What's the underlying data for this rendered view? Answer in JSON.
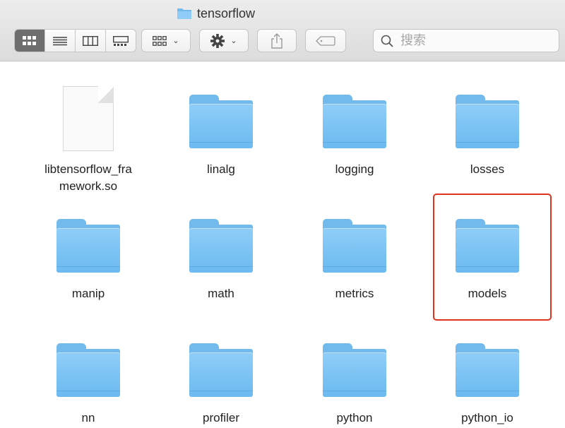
{
  "window": {
    "title": "tensorflow",
    "title_icon": "folder-icon"
  },
  "toolbar": {
    "view_modes": [
      {
        "name": "icon-view",
        "icon": "grid-icon",
        "active": true
      },
      {
        "name": "list-view",
        "icon": "list-icon",
        "active": false
      },
      {
        "name": "column-view",
        "icon": "columns-icon",
        "active": false
      },
      {
        "name": "gallery-view",
        "icon": "gallery-icon",
        "active": false
      }
    ],
    "group_icon": "group-by-icon",
    "action_icon": "gear-icon",
    "share_icon": "share-icon",
    "tag_icon": "tag-icon",
    "dropdown_arrow": "⌄",
    "search": {
      "placeholder": "搜索",
      "value": ""
    }
  },
  "items": [
    {
      "name": "libtensorflow_framework.so",
      "label_line1": "libtensorflow_fra",
      "label_line2": "mework.so",
      "type": "document"
    },
    {
      "name": "linalg",
      "label": "linalg",
      "type": "folder"
    },
    {
      "name": "logging",
      "label": "logging",
      "type": "folder"
    },
    {
      "name": "losses",
      "label": "losses",
      "type": "folder"
    },
    {
      "name": "manip",
      "label": "manip",
      "type": "folder"
    },
    {
      "name": "math",
      "label": "math",
      "type": "folder"
    },
    {
      "name": "metrics",
      "label": "metrics",
      "type": "folder"
    },
    {
      "name": "models",
      "label": "models",
      "type": "folder",
      "highlighted": true
    },
    {
      "name": "nn",
      "label": "nn",
      "type": "folder"
    },
    {
      "name": "profiler",
      "label": "profiler",
      "type": "folder"
    },
    {
      "name": "python",
      "label": "python",
      "type": "folder"
    },
    {
      "name": "python_io",
      "label": "python_io",
      "type": "folder"
    }
  ],
  "colors": {
    "folder_blue": "#72b9ec",
    "highlight_red": "#e0331f",
    "toolbar_bg": "#e4e4e4"
  }
}
